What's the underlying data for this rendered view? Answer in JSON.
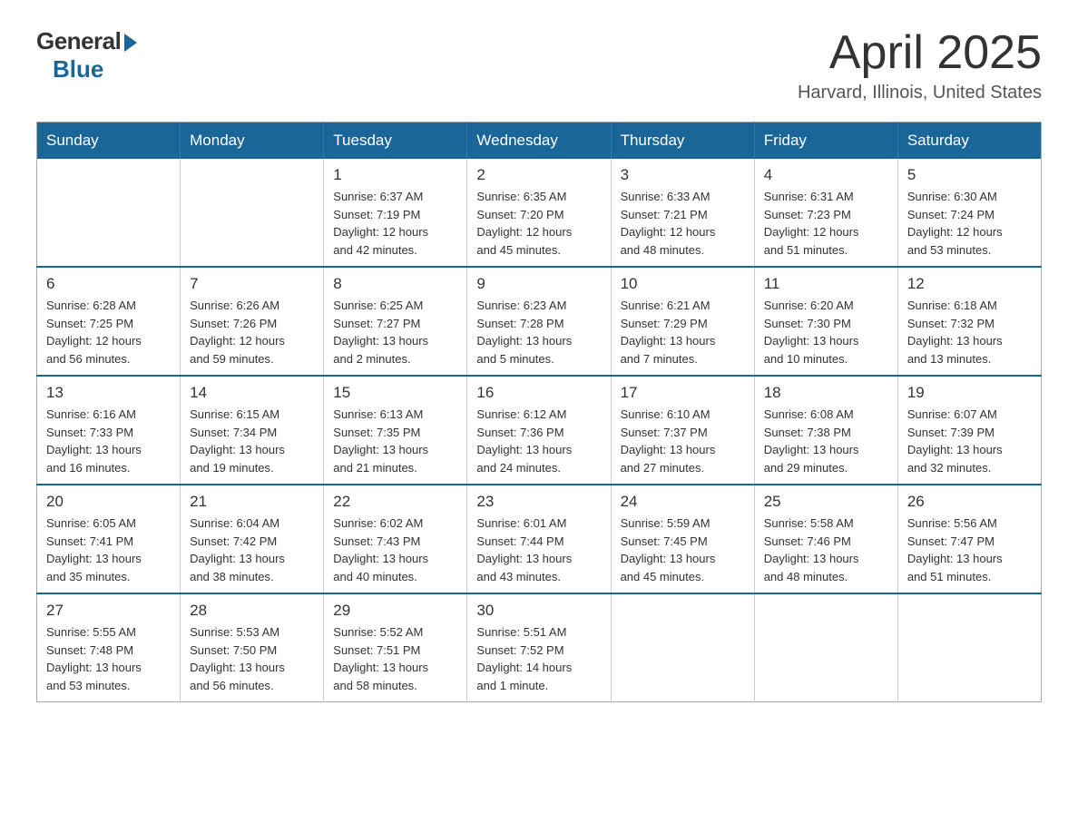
{
  "header": {
    "logo": {
      "general": "General",
      "blue": "Blue"
    },
    "title": "April 2025",
    "location": "Harvard, Illinois, United States"
  },
  "days_of_week": [
    "Sunday",
    "Monday",
    "Tuesday",
    "Wednesday",
    "Thursday",
    "Friday",
    "Saturday"
  ],
  "weeks": [
    [
      {
        "day": "",
        "info": ""
      },
      {
        "day": "",
        "info": ""
      },
      {
        "day": "1",
        "info": "Sunrise: 6:37 AM\nSunset: 7:19 PM\nDaylight: 12 hours\nand 42 minutes."
      },
      {
        "day": "2",
        "info": "Sunrise: 6:35 AM\nSunset: 7:20 PM\nDaylight: 12 hours\nand 45 minutes."
      },
      {
        "day": "3",
        "info": "Sunrise: 6:33 AM\nSunset: 7:21 PM\nDaylight: 12 hours\nand 48 minutes."
      },
      {
        "day": "4",
        "info": "Sunrise: 6:31 AM\nSunset: 7:23 PM\nDaylight: 12 hours\nand 51 minutes."
      },
      {
        "day": "5",
        "info": "Sunrise: 6:30 AM\nSunset: 7:24 PM\nDaylight: 12 hours\nand 53 minutes."
      }
    ],
    [
      {
        "day": "6",
        "info": "Sunrise: 6:28 AM\nSunset: 7:25 PM\nDaylight: 12 hours\nand 56 minutes."
      },
      {
        "day": "7",
        "info": "Sunrise: 6:26 AM\nSunset: 7:26 PM\nDaylight: 12 hours\nand 59 minutes."
      },
      {
        "day": "8",
        "info": "Sunrise: 6:25 AM\nSunset: 7:27 PM\nDaylight: 13 hours\nand 2 minutes."
      },
      {
        "day": "9",
        "info": "Sunrise: 6:23 AM\nSunset: 7:28 PM\nDaylight: 13 hours\nand 5 minutes."
      },
      {
        "day": "10",
        "info": "Sunrise: 6:21 AM\nSunset: 7:29 PM\nDaylight: 13 hours\nand 7 minutes."
      },
      {
        "day": "11",
        "info": "Sunrise: 6:20 AM\nSunset: 7:30 PM\nDaylight: 13 hours\nand 10 minutes."
      },
      {
        "day": "12",
        "info": "Sunrise: 6:18 AM\nSunset: 7:32 PM\nDaylight: 13 hours\nand 13 minutes."
      }
    ],
    [
      {
        "day": "13",
        "info": "Sunrise: 6:16 AM\nSunset: 7:33 PM\nDaylight: 13 hours\nand 16 minutes."
      },
      {
        "day": "14",
        "info": "Sunrise: 6:15 AM\nSunset: 7:34 PM\nDaylight: 13 hours\nand 19 minutes."
      },
      {
        "day": "15",
        "info": "Sunrise: 6:13 AM\nSunset: 7:35 PM\nDaylight: 13 hours\nand 21 minutes."
      },
      {
        "day": "16",
        "info": "Sunrise: 6:12 AM\nSunset: 7:36 PM\nDaylight: 13 hours\nand 24 minutes."
      },
      {
        "day": "17",
        "info": "Sunrise: 6:10 AM\nSunset: 7:37 PM\nDaylight: 13 hours\nand 27 minutes."
      },
      {
        "day": "18",
        "info": "Sunrise: 6:08 AM\nSunset: 7:38 PM\nDaylight: 13 hours\nand 29 minutes."
      },
      {
        "day": "19",
        "info": "Sunrise: 6:07 AM\nSunset: 7:39 PM\nDaylight: 13 hours\nand 32 minutes."
      }
    ],
    [
      {
        "day": "20",
        "info": "Sunrise: 6:05 AM\nSunset: 7:41 PM\nDaylight: 13 hours\nand 35 minutes."
      },
      {
        "day": "21",
        "info": "Sunrise: 6:04 AM\nSunset: 7:42 PM\nDaylight: 13 hours\nand 38 minutes."
      },
      {
        "day": "22",
        "info": "Sunrise: 6:02 AM\nSunset: 7:43 PM\nDaylight: 13 hours\nand 40 minutes."
      },
      {
        "day": "23",
        "info": "Sunrise: 6:01 AM\nSunset: 7:44 PM\nDaylight: 13 hours\nand 43 minutes."
      },
      {
        "day": "24",
        "info": "Sunrise: 5:59 AM\nSunset: 7:45 PM\nDaylight: 13 hours\nand 45 minutes."
      },
      {
        "day": "25",
        "info": "Sunrise: 5:58 AM\nSunset: 7:46 PM\nDaylight: 13 hours\nand 48 minutes."
      },
      {
        "day": "26",
        "info": "Sunrise: 5:56 AM\nSunset: 7:47 PM\nDaylight: 13 hours\nand 51 minutes."
      }
    ],
    [
      {
        "day": "27",
        "info": "Sunrise: 5:55 AM\nSunset: 7:48 PM\nDaylight: 13 hours\nand 53 minutes."
      },
      {
        "day": "28",
        "info": "Sunrise: 5:53 AM\nSunset: 7:50 PM\nDaylight: 13 hours\nand 56 minutes."
      },
      {
        "day": "29",
        "info": "Sunrise: 5:52 AM\nSunset: 7:51 PM\nDaylight: 13 hours\nand 58 minutes."
      },
      {
        "day": "30",
        "info": "Sunrise: 5:51 AM\nSunset: 7:52 PM\nDaylight: 14 hours\nand 1 minute."
      },
      {
        "day": "",
        "info": ""
      },
      {
        "day": "",
        "info": ""
      },
      {
        "day": "",
        "info": ""
      }
    ]
  ]
}
